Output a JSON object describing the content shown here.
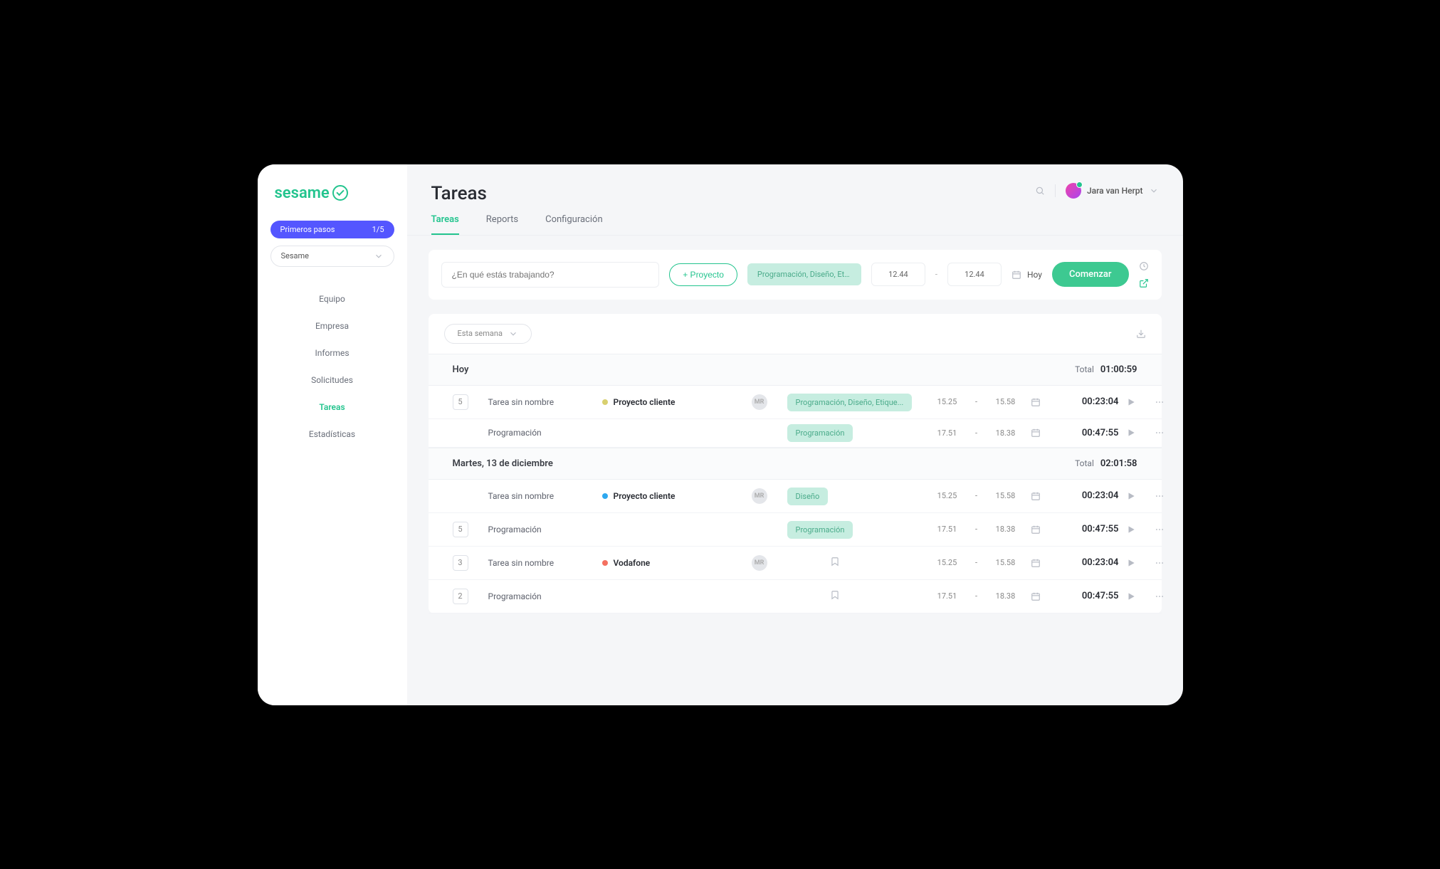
{
  "logo_text": "sesame",
  "steps_badge": {
    "label": "Primeros pasos",
    "progress": "1/5"
  },
  "workspace": "Sesame",
  "nav": [
    {
      "label": "Equipo",
      "active": false
    },
    {
      "label": "Empresa",
      "active": false
    },
    {
      "label": "Informes",
      "active": false
    },
    {
      "label": "Solicitudes",
      "active": false
    },
    {
      "label": "Tareas",
      "active": true
    },
    {
      "label": "Estadísticas",
      "active": false
    }
  ],
  "page_title": "Tareas",
  "user_name": "Jara van Herpt",
  "tabs": [
    {
      "label": "Tareas",
      "active": true
    },
    {
      "label": "Reports",
      "active": false
    },
    {
      "label": "Configuración",
      "active": false
    }
  ],
  "entry": {
    "placeholder": "¿En qué estás trabajando?",
    "project_btn": "+ Proyecto",
    "tags_chip": "Programación, Diseño, Etique...",
    "time_from": "12.44",
    "time_to": "12.44",
    "today_label": "Hoy",
    "start_btn": "Comenzar"
  },
  "list": {
    "week_filter": "Esta semana",
    "groups": [
      {
        "title": "Hoy",
        "total_label": "Total",
        "total_value": "01:00:59",
        "rows": [
          {
            "count": "5",
            "name": "Tarea sin nombre",
            "project": "Proyecto cliente",
            "color": "#d8d06f",
            "avatar": "MR",
            "tag": "Programación, Diseño, Etique...",
            "from": "15.25",
            "to": "15.58",
            "duration": "00:23:04"
          },
          {
            "count": "",
            "name": "Programación",
            "project": "",
            "color": "",
            "avatar": "",
            "tag": "Programación",
            "from": "17.51",
            "to": "18.38",
            "duration": "00:47:55"
          }
        ]
      },
      {
        "title": "Martes, 13 de diciembre",
        "total_label": "Total",
        "total_value": "02:01:58",
        "rows": [
          {
            "count": "",
            "name": "Tarea sin nombre",
            "project": "Proyecto cliente",
            "color": "#2ea8ef",
            "avatar": "MR",
            "tag": "Diseño",
            "from": "15.25",
            "to": "15.58",
            "duration": "00:23:04"
          },
          {
            "count": "5",
            "name": "Programación",
            "project": "",
            "color": "",
            "avatar": "",
            "tag": "Programación",
            "from": "17.51",
            "to": "18.38",
            "duration": "00:47:55"
          },
          {
            "count": "3",
            "name": "Tarea sin nombre",
            "project": "Vodafone",
            "color": "#f47060",
            "avatar": "MR",
            "bookmark": true,
            "from": "15.25",
            "to": "15.58",
            "duration": "00:23:04"
          },
          {
            "count": "2",
            "name": "Programación",
            "project": "",
            "color": "",
            "avatar": "",
            "bookmark": true,
            "from": "17.51",
            "to": "18.38",
            "duration": "00:47:55"
          }
        ]
      }
    ]
  }
}
